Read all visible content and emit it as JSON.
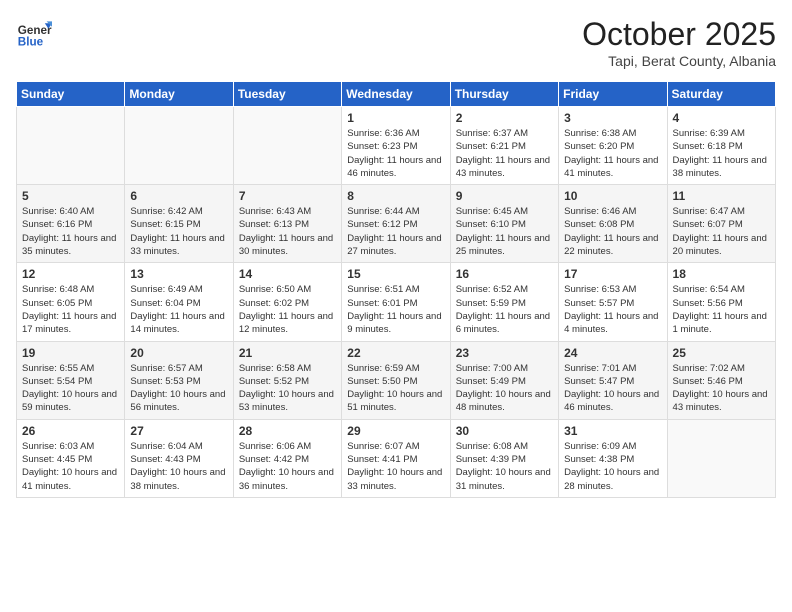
{
  "header": {
    "logo_general": "General",
    "logo_blue": "Blue",
    "month": "October 2025",
    "location": "Tapi, Berat County, Albania"
  },
  "days_of_week": [
    "Sunday",
    "Monday",
    "Tuesday",
    "Wednesday",
    "Thursday",
    "Friday",
    "Saturday"
  ],
  "weeks": [
    [
      {
        "num": "",
        "info": ""
      },
      {
        "num": "",
        "info": ""
      },
      {
        "num": "",
        "info": ""
      },
      {
        "num": "1",
        "info": "Sunrise: 6:36 AM\nSunset: 6:23 PM\nDaylight: 11 hours\nand 46 minutes."
      },
      {
        "num": "2",
        "info": "Sunrise: 6:37 AM\nSunset: 6:21 PM\nDaylight: 11 hours\nand 43 minutes."
      },
      {
        "num": "3",
        "info": "Sunrise: 6:38 AM\nSunset: 6:20 PM\nDaylight: 11 hours\nand 41 minutes."
      },
      {
        "num": "4",
        "info": "Sunrise: 6:39 AM\nSunset: 6:18 PM\nDaylight: 11 hours\nand 38 minutes."
      }
    ],
    [
      {
        "num": "5",
        "info": "Sunrise: 6:40 AM\nSunset: 6:16 PM\nDaylight: 11 hours\nand 35 minutes."
      },
      {
        "num": "6",
        "info": "Sunrise: 6:42 AM\nSunset: 6:15 PM\nDaylight: 11 hours\nand 33 minutes."
      },
      {
        "num": "7",
        "info": "Sunrise: 6:43 AM\nSunset: 6:13 PM\nDaylight: 11 hours\nand 30 minutes."
      },
      {
        "num": "8",
        "info": "Sunrise: 6:44 AM\nSunset: 6:12 PM\nDaylight: 11 hours\nand 27 minutes."
      },
      {
        "num": "9",
        "info": "Sunrise: 6:45 AM\nSunset: 6:10 PM\nDaylight: 11 hours\nand 25 minutes."
      },
      {
        "num": "10",
        "info": "Sunrise: 6:46 AM\nSunset: 6:08 PM\nDaylight: 11 hours\nand 22 minutes."
      },
      {
        "num": "11",
        "info": "Sunrise: 6:47 AM\nSunset: 6:07 PM\nDaylight: 11 hours\nand 20 minutes."
      }
    ],
    [
      {
        "num": "12",
        "info": "Sunrise: 6:48 AM\nSunset: 6:05 PM\nDaylight: 11 hours\nand 17 minutes."
      },
      {
        "num": "13",
        "info": "Sunrise: 6:49 AM\nSunset: 6:04 PM\nDaylight: 11 hours\nand 14 minutes."
      },
      {
        "num": "14",
        "info": "Sunrise: 6:50 AM\nSunset: 6:02 PM\nDaylight: 11 hours\nand 12 minutes."
      },
      {
        "num": "15",
        "info": "Sunrise: 6:51 AM\nSunset: 6:01 PM\nDaylight: 11 hours\nand 9 minutes."
      },
      {
        "num": "16",
        "info": "Sunrise: 6:52 AM\nSunset: 5:59 PM\nDaylight: 11 hours\nand 6 minutes."
      },
      {
        "num": "17",
        "info": "Sunrise: 6:53 AM\nSunset: 5:57 PM\nDaylight: 11 hours\nand 4 minutes."
      },
      {
        "num": "18",
        "info": "Sunrise: 6:54 AM\nSunset: 5:56 PM\nDaylight: 11 hours\nand 1 minute."
      }
    ],
    [
      {
        "num": "19",
        "info": "Sunrise: 6:55 AM\nSunset: 5:54 PM\nDaylight: 10 hours\nand 59 minutes."
      },
      {
        "num": "20",
        "info": "Sunrise: 6:57 AM\nSunset: 5:53 PM\nDaylight: 10 hours\nand 56 minutes."
      },
      {
        "num": "21",
        "info": "Sunrise: 6:58 AM\nSunset: 5:52 PM\nDaylight: 10 hours\nand 53 minutes."
      },
      {
        "num": "22",
        "info": "Sunrise: 6:59 AM\nSunset: 5:50 PM\nDaylight: 10 hours\nand 51 minutes."
      },
      {
        "num": "23",
        "info": "Sunrise: 7:00 AM\nSunset: 5:49 PM\nDaylight: 10 hours\nand 48 minutes."
      },
      {
        "num": "24",
        "info": "Sunrise: 7:01 AM\nSunset: 5:47 PM\nDaylight: 10 hours\nand 46 minutes."
      },
      {
        "num": "25",
        "info": "Sunrise: 7:02 AM\nSunset: 5:46 PM\nDaylight: 10 hours\nand 43 minutes."
      }
    ],
    [
      {
        "num": "26",
        "info": "Sunrise: 6:03 AM\nSunset: 4:45 PM\nDaylight: 10 hours\nand 41 minutes."
      },
      {
        "num": "27",
        "info": "Sunrise: 6:04 AM\nSunset: 4:43 PM\nDaylight: 10 hours\nand 38 minutes."
      },
      {
        "num": "28",
        "info": "Sunrise: 6:06 AM\nSunset: 4:42 PM\nDaylight: 10 hours\nand 36 minutes."
      },
      {
        "num": "29",
        "info": "Sunrise: 6:07 AM\nSunset: 4:41 PM\nDaylight: 10 hours\nand 33 minutes."
      },
      {
        "num": "30",
        "info": "Sunrise: 6:08 AM\nSunset: 4:39 PM\nDaylight: 10 hours\nand 31 minutes."
      },
      {
        "num": "31",
        "info": "Sunrise: 6:09 AM\nSunset: 4:38 PM\nDaylight: 10 hours\nand 28 minutes."
      },
      {
        "num": "",
        "info": ""
      }
    ]
  ]
}
